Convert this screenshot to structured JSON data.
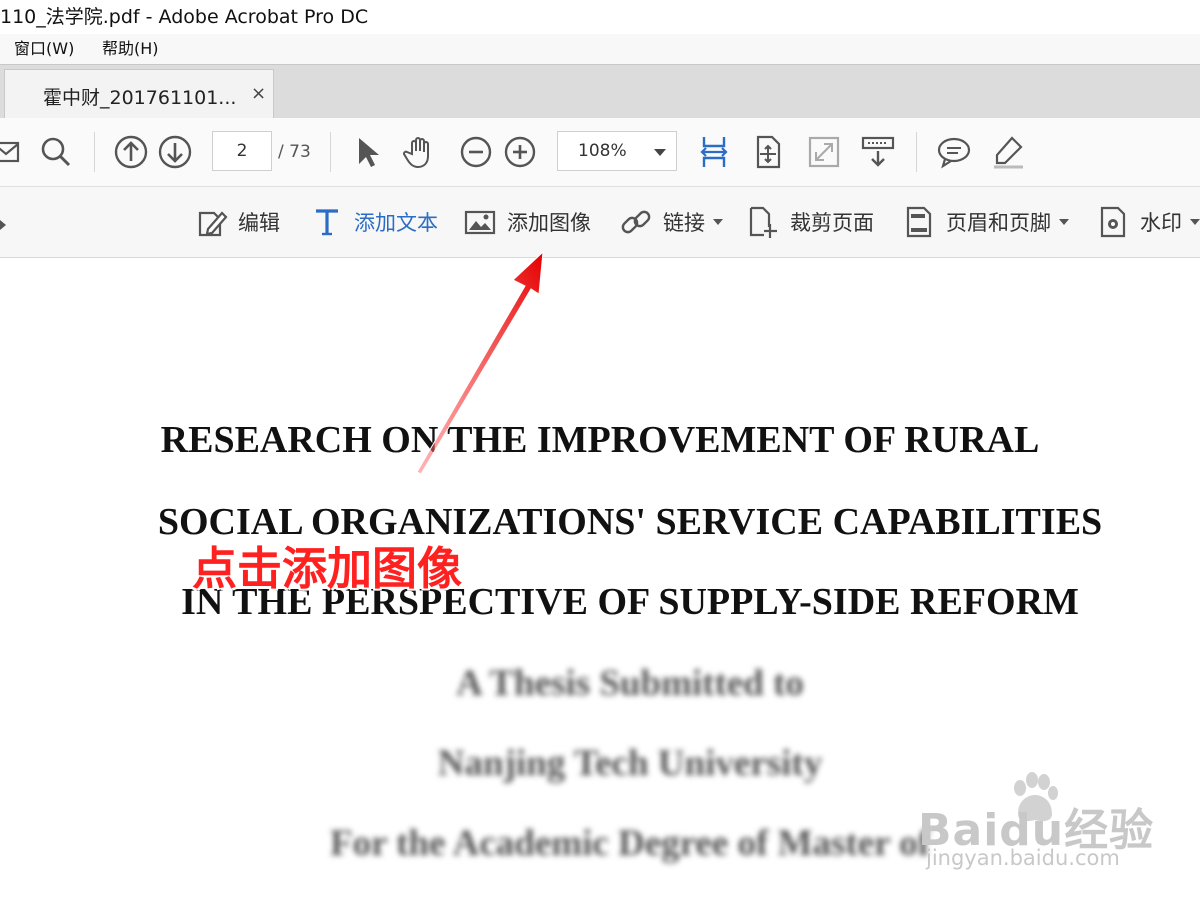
{
  "window": {
    "title": "110_法学院.pdf - Adobe Acrobat Pro DC"
  },
  "menu": {
    "items": [
      "窗口(W)",
      "帮助(H)"
    ]
  },
  "tabs": [
    {
      "label": "霍中财_201761101...",
      "close": "×"
    }
  ],
  "toolbar": {
    "page_current": "2",
    "page_total": "/ 73",
    "zoom": "108%"
  },
  "edit_toolbar": {
    "items": [
      {
        "label": "编辑",
        "icon": "edit-icon",
        "dropdown": false
      },
      {
        "label": "添加文本",
        "icon": "text-icon",
        "dropdown": false,
        "color": "#2b6cc4"
      },
      {
        "label": "添加图像",
        "icon": "image-icon",
        "dropdown": false
      },
      {
        "label": "链接",
        "icon": "link-icon",
        "dropdown": true
      },
      {
        "label": "裁剪页面",
        "icon": "crop-icon",
        "dropdown": false
      },
      {
        "label": "页眉和页脚",
        "icon": "header-footer-icon",
        "dropdown": true
      },
      {
        "label": "水印",
        "icon": "watermark-icon",
        "dropdown": true
      }
    ]
  },
  "document": {
    "title_lines": [
      "RESEARCH ON THE IMPROVEMENT OF RURAL",
      "SOCIAL ORGANIZATIONS' SERVICE CAPABILITIES",
      "IN THE PERSPECTIVE OF SUPPLY-SIDE REFORM"
    ],
    "subtitle_lines": [
      "A Thesis Submitted to",
      "Nanjing Tech University",
      "For the Academic Degree of Master of"
    ]
  },
  "annotation": {
    "text": "点击添加图像",
    "color": "#ff2020"
  },
  "watermark": {
    "brand": "Baidu经验",
    "site": "jingyan.baidu.com"
  },
  "colors": {
    "accent_blue": "#2b6cc4",
    "annotation_red": "#ff2020"
  }
}
